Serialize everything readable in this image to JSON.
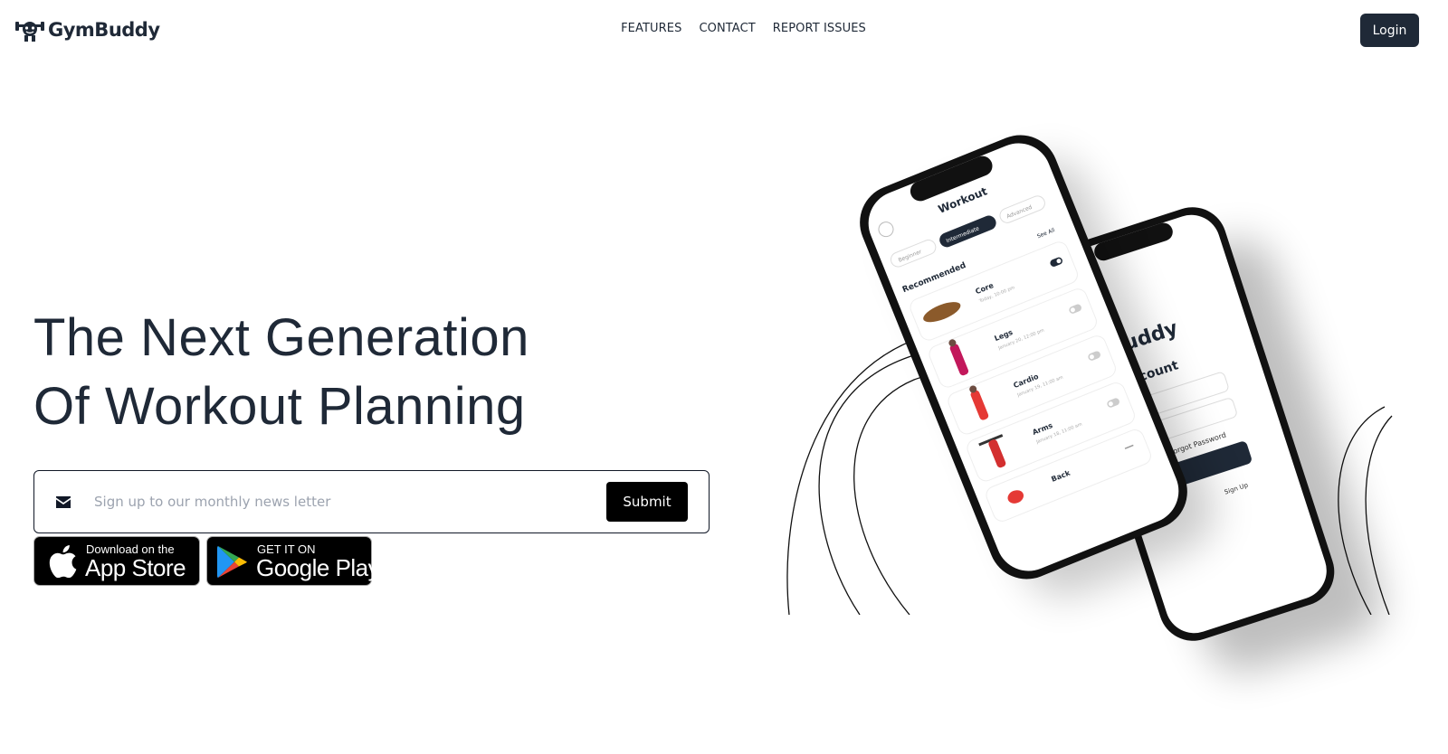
{
  "brand": {
    "name": "GymBuddy",
    "logo_icon": "gym-mascot-icon"
  },
  "nav": {
    "items": [
      {
        "label": "FEATURES"
      },
      {
        "label": "CONTACT"
      },
      {
        "label": "REPORT ISSUES"
      }
    ]
  },
  "header": {
    "login_label": "Login"
  },
  "hero": {
    "title_line1": "The Next Generation",
    "title_line2": "Of Workout Planning"
  },
  "newsletter": {
    "icon": "envelope-icon",
    "placeholder": "Sign up to our monthly news letter",
    "value": "",
    "submit_label": "Submit"
  },
  "stores": {
    "apple": {
      "small": "Download on the",
      "big": "App Store",
      "icon": "apple-icon"
    },
    "google": {
      "small": "GET IT ON",
      "big": "Google Play",
      "icon": "google-play-icon"
    }
  },
  "phone_front": {
    "title": "Workout",
    "tabs": [
      "Beginner",
      "Intermediate",
      "Advanced"
    ],
    "active_tab": "Intermediate",
    "section": "Recommended",
    "see_all": "See All",
    "workouts": [
      {
        "name": "Core",
        "date": "Today, 10:00 pm",
        "toggle": "on"
      },
      {
        "name": "Legs",
        "date": "January 20, 12:00 pm",
        "toggle": "off"
      },
      {
        "name": "Cardio",
        "date": "January 19, 11:00 am",
        "toggle": "off"
      },
      {
        "name": "Arms",
        "date": "January 18, 11:00 am",
        "toggle": "off"
      },
      {
        "name": "Back",
        "date": "",
        "toggle": "off"
      }
    ]
  },
  "phone_back": {
    "brand_fragment": "uddy",
    "heading_fragment": "count",
    "forgot": "orgot Password",
    "signup": "Sign Up"
  },
  "colors": {
    "primary": "#1f2937",
    "black": "#000000",
    "white": "#ffffff",
    "placeholder": "#9ca3af"
  }
}
